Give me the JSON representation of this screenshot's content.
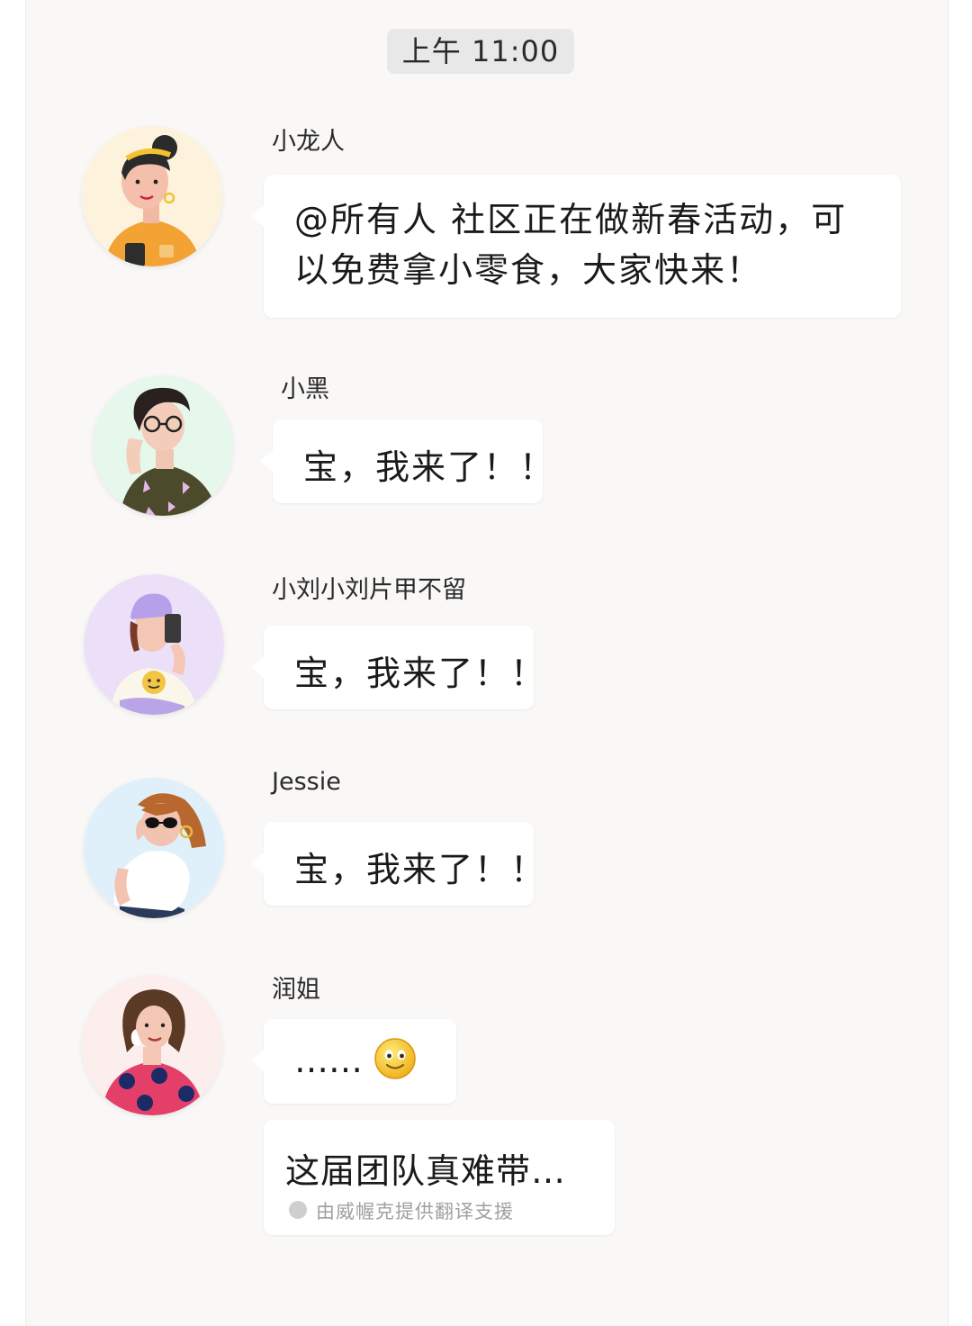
{
  "timestamp": "上午 11:00",
  "messages": [
    {
      "sender": "小龙人",
      "text": "@所有人  社区正在做新春活动，可以免费拿小零食，大家快来！"
    },
    {
      "sender": "小黑",
      "text": "宝，我来了！！"
    },
    {
      "sender": "小刘小刘片甲不留",
      "text": "宝，我来了！！"
    },
    {
      "sender": "Jessie",
      "text": "宝，我来了！！"
    },
    {
      "sender": "润姐",
      "text": "……",
      "emoji": "smile-emoji-icon",
      "followup": {
        "text": "这届团队真难带…",
        "note": "由威幄克提供翻译支援"
      }
    }
  ],
  "colors": {
    "bg": "#f9f8f7",
    "bubble": "#ffffff",
    "timestamp_bg": "#e8e8e8"
  }
}
